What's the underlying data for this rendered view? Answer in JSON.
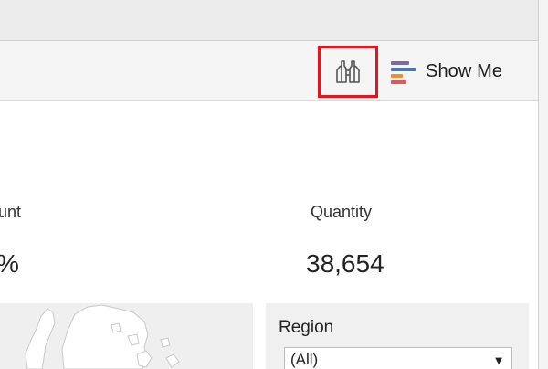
{
  "toolbar": {
    "find_icon": "binoculars-icon",
    "show_me_label": "Show Me",
    "show_me_colors": [
      "#7b6aa8",
      "#4e79a7",
      "#f28e2b",
      "#e15759"
    ]
  },
  "kpis": [
    {
      "label": "unt",
      "value": "%"
    },
    {
      "label": "Quantity",
      "value": "38,654"
    }
  ],
  "filter": {
    "title": "Region",
    "selected": "(All)"
  }
}
